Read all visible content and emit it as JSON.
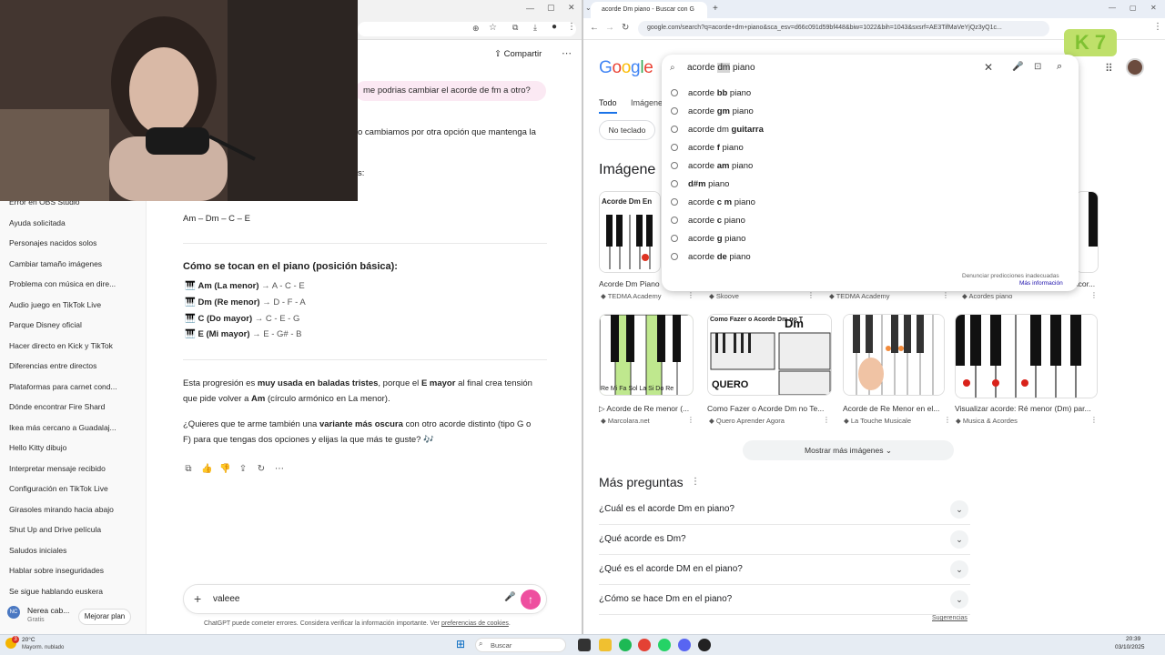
{
  "chatgpt": {
    "share_label": "Compartir",
    "user_message": "me podrias cambiar el acorde de fm a otro?",
    "reply_partial": "o cambiamos por otra opción que mantenga la",
    "reply_partial2": "s:",
    "progression": "Am – Dm – C – E",
    "how_title": "Cómo se tocan en el piano (posición básica):",
    "chords": [
      {
        "name": "Am (La menor)",
        "notes": "→ A - C - E"
      },
      {
        "name": "Dm (Re menor)",
        "notes": "→ D - F - A"
      },
      {
        "name": "C (Do mayor)",
        "notes": "→ C - E - G"
      },
      {
        "name": "E (Mi mayor)",
        "notes": "→ E - G# - B"
      }
    ],
    "para1_a": "Esta progresión es ",
    "para1_b": "muy usada en baladas tristes",
    "para1_c": ", porque el ",
    "para1_d": "E mayor",
    "para1_e": " al final crea tensión",
    "para1_f": "que pide volver a ",
    "para1_g": "Am",
    "para1_h": " (círculo armónico en La menor).",
    "para2_a": "¿Quieres que te arme también una ",
    "para2_b": "variante más oscura",
    "para2_c": " con otro acorde distinto (tipo G o",
    "para2_d": "F) para que tengas dos opciones y elijas la que más te guste? 🎶",
    "composer_text": "valeee",
    "disclaimer_a": "ChatGPT puede cometer errores. Considera verificar la información importante. Ver ",
    "disclaimer_link": "preferencias de cookies",
    "disclaimer_end": ".",
    "sidebar": [
      "Error en OBS Studio",
      "Ayuda solicitada",
      "Personajes nacidos solos",
      "Cambiar tamaño imágenes",
      "Problema con música en dire...",
      "Audio juego en TikTok Live",
      "Parque Disney oficial",
      "Hacer directo en Kick y TikTok",
      "Diferencias entre directos",
      "Plataformas para carnet cond...",
      "Dónde encontrar Fire Shard",
      "Ikea más cercano a Guadalaj...",
      "Hello Kitty dibujo",
      "Interpretar mensaje recibido",
      "Configuración en TikTok Live",
      "Girasoles mirando hacia abajo",
      "Shut Up and Drive película",
      "Saludos iniciales",
      "Hablar sobre inseguridades",
      "Se sigue hablando euskera"
    ],
    "user": {
      "initials": "NC",
      "name": "Nerea cab...",
      "plan": "Gratis",
      "upgrade": "Mejorar plan"
    }
  },
  "google": {
    "tab_title": "acorde Dm piano - Buscar con G",
    "url": "google.com/search?q=acorde+dm+piano&sca_esv=d66c091d59bf448&biw=1022&bih=1043&sxsrf=AE3TifMaVeYjQz3yQ1c...",
    "logo": "Google",
    "query_a": "acorde ",
    "query_b": "dm",
    "query_c": " piano",
    "suggestions": [
      {
        "a": "acorde ",
        "b": "bb",
        "c": " piano"
      },
      {
        "a": "acorde ",
        "b": "gm",
        "c": " piano"
      },
      {
        "a": "acorde dm ",
        "b": "guitarra",
        "c": ""
      },
      {
        "a": "acorde ",
        "b": "f",
        "c": " piano"
      },
      {
        "a": "acorde ",
        "b": "am",
        "c": " piano"
      },
      {
        "a": "",
        "b": "d#m",
        "c": " piano"
      },
      {
        "a": "acorde ",
        "b": "c m",
        "c": " piano"
      },
      {
        "a": "acorde ",
        "b": "c",
        "c": " piano"
      },
      {
        "a": "acorde ",
        "b": "g",
        "c": " piano"
      },
      {
        "a": "acorde ",
        "b": "de",
        "c": " piano"
      }
    ],
    "report": "Denunciar predicciones inadecuadas",
    "more_info": "Más información",
    "tabs": [
      "Todo",
      "Imágene"
    ],
    "chip": "No teclado",
    "images_title": "Imágene",
    "row1": [
      {
        "cap": "Acorde Dm Piano",
        "src": "TEDMA Academy",
        "label": "Acorde Dm En"
      },
      {
        "cap": "",
        "src": "Skoove",
        "label": ""
      },
      {
        "cap": "",
        "src": "TEDMA Academy",
        "label": ""
      },
      {
        "cap": "Acor...",
        "src": "Acordes piano",
        "label": ""
      }
    ],
    "row2": [
      {
        "cap": "▷ Acorde de Re menor (...",
        "src": "Marcolara.net",
        "label": "Re Mi Fa Sol La Si Do Re"
      },
      {
        "cap": "Como Fazer o Acorde Dm no Te...",
        "src": "Quero Aprender Agora",
        "label": "Como Fazer o Acorde Dm no T"
      },
      {
        "cap": "Acorde de Re Menor en el...",
        "src": "La Touche Musicale",
        "label": ""
      },
      {
        "cap": "Visualizar acorde: Ré menor (Dm) par...",
        "src": "Musica & Acordes",
        "label": ""
      }
    ],
    "more_images": "Mostrar más imágenes",
    "faq_title": "Más preguntas",
    "faq": [
      "¿Cuál es el acorde Dm en piano?",
      "¿Qué acorde es Dm?",
      "¿Qué es el acorde DM en el piano?",
      "¿Cómo se hace Dm en el piano?"
    ],
    "feedback": "Sugerencias"
  },
  "overlay": {
    "k7": "K 7"
  },
  "taskbar": {
    "weather_temp": "20°C",
    "weather_desc": "Mayorm. nublado",
    "search": "Buscar",
    "time": "20:39",
    "date": "03/10/2025",
    "badge": "3"
  }
}
